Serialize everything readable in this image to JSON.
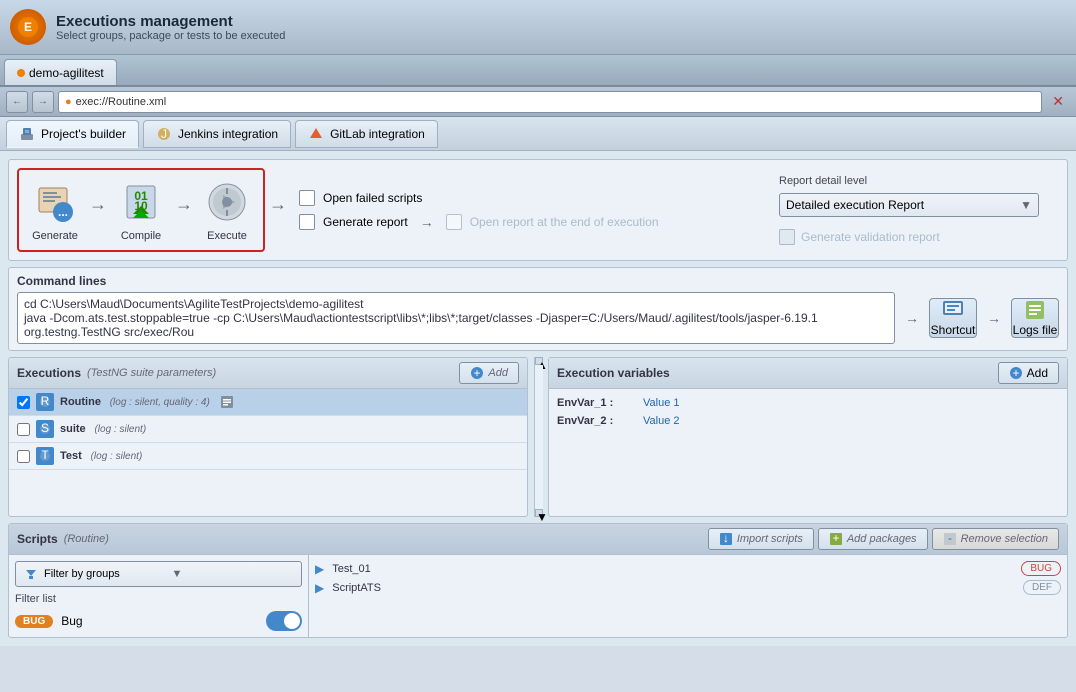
{
  "app": {
    "title": "Executions management",
    "subtitle": "Select groups, package or tests to be executed",
    "icon_text": "E"
  },
  "tab": {
    "label": "demo-agilitest"
  },
  "url_bar": {
    "url": "exec://Routine.xml"
  },
  "toolbar_tabs": [
    {
      "id": "projects",
      "label": "Project's builder",
      "active": true
    },
    {
      "id": "jenkins",
      "label": "Jenkins integration",
      "active": false
    },
    {
      "id": "gitlab",
      "label": "GitLab integration",
      "active": false
    }
  ],
  "workflow": {
    "steps": [
      {
        "id": "generate",
        "label": "Generate"
      },
      {
        "id": "compile",
        "label": "Compile"
      },
      {
        "id": "execute",
        "label": "Execute"
      }
    ],
    "open_failed_scripts": {
      "label": "Open failed scripts",
      "checked": false
    },
    "generate_report": {
      "label": "Generate report",
      "checked": false
    },
    "open_report": {
      "label": "Open  report at the end of execution",
      "checked": false
    },
    "report_detail": {
      "label": "Report detail level",
      "selected": "Detailed execution Report"
    },
    "generate_validation": {
      "label": "Generate validation report",
      "disabled": true
    }
  },
  "command_lines": {
    "title": "Command lines",
    "text_line1": "cd C:\\Users\\Maud\\Documents\\AgiliteTestProjects\\demo-agilitest",
    "text_line2": "java -Dcom.ats.test.stoppable=true -cp C:\\Users\\Maud\\actiontestscript\\libs\\*;libs\\*;target/classes -Djasper=C:/Users/Maud/.agilitest/tools/jasper-6.19.1 org.testng.TestNG src/exec/Rou",
    "shortcut_label": "Shortcut",
    "logs_label": "Logs file"
  },
  "executions": {
    "title": "Executions",
    "subtitle": "(TestNG suite parameters)",
    "add_label": "Add",
    "items": [
      {
        "id": "routine",
        "name": "Routine",
        "info": "log : silent, quality : 4",
        "selected": true,
        "has_icon2": true
      },
      {
        "id": "suite",
        "name": "suite",
        "info": "log : silent",
        "selected": false
      },
      {
        "id": "test",
        "name": "Test",
        "info": "log : silent",
        "selected": false
      }
    ]
  },
  "execution_variables": {
    "title": "Execution variables",
    "add_label": "Add",
    "items": [
      {
        "name": "EnvVar_1 :",
        "value": "Value 1"
      },
      {
        "name": "EnvVar_2 :",
        "value": "Value 2"
      }
    ]
  },
  "scripts": {
    "title": "Scripts",
    "subtitle": "(Routine)",
    "import_label": "Import scripts",
    "add_packages_label": "Add packages",
    "remove_label": "Remove selection",
    "filter": {
      "placeholder": "Filter by groups",
      "list_label": "Filter list",
      "items": [
        {
          "tag": "BUG",
          "name": "Bug",
          "enabled": true
        }
      ]
    },
    "items": [
      {
        "name": "Test_01",
        "badge": "BUG",
        "badge_type": "bug"
      },
      {
        "name": "ScriptATS",
        "badge": "DEF",
        "badge_type": "def"
      }
    ]
  }
}
